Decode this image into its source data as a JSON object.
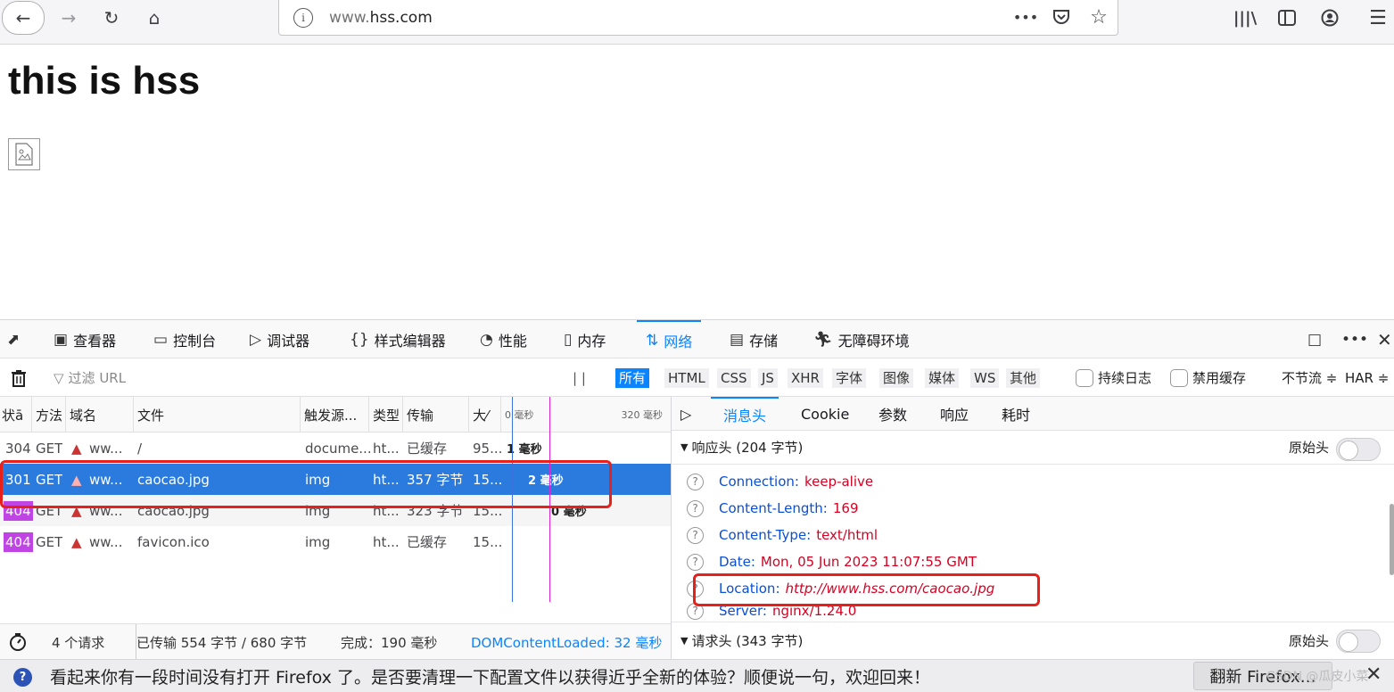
{
  "browser": {
    "url_host": "www.hss.com",
    "url_prefix": "www.",
    "url_domain": "hss.com",
    "icons": [
      "back-arrow-icon",
      "forward-arrow-icon",
      "reload-icon",
      "home-icon",
      "info-icon",
      "page-actions-icon",
      "pocket-icon",
      "bookmark-star-icon",
      "library-icon",
      "sidebar-icon",
      "account-icon",
      "menu-icon"
    ]
  },
  "page": {
    "heading": "this is hss"
  },
  "devtools": {
    "tabs": [
      {
        "label": "查看器",
        "icon": "inspector-icon"
      },
      {
        "label": "控制台",
        "icon": "console-icon"
      },
      {
        "label": "调试器",
        "icon": "debugger-icon"
      },
      {
        "label": "样式编辑器",
        "icon": "style-editor-icon"
      },
      {
        "label": "性能",
        "icon": "performance-icon"
      },
      {
        "label": "内存",
        "icon": "memory-icon"
      },
      {
        "label": "网络",
        "icon": "network-icon"
      },
      {
        "label": "存储",
        "icon": "storage-icon"
      },
      {
        "label": "无障碍环境",
        "icon": "accessibility-icon"
      }
    ],
    "selected_tab": "网络",
    "filter_placeholder": "过滤 URL",
    "pause_label": "| |",
    "type_filters": [
      "所有",
      "HTML",
      "CSS",
      "JS",
      "XHR",
      "字体",
      "图像",
      "媒体",
      "WS",
      "其他"
    ],
    "persist_logs": "持续日志",
    "disable_cache": "禁用缓存",
    "throttle": "不节流 ≑",
    "har": "HAR ≑",
    "columns": [
      "状态",
      "方法",
      "域名",
      "文件",
      "触发源...",
      "类型",
      "传输",
      "大小"
    ],
    "columns_shown": [
      "状ā",
      "方法",
      "域名",
      "文件",
      "触发源...",
      "类型",
      "传输",
      "大⁄"
    ],
    "waterfall_ticks": [
      "0 毫秒",
      "320 毫秒"
    ],
    "requests": [
      {
        "status": "304",
        "method": "GET",
        "domain": "ww...",
        "file": "/",
        "cause": "docume...",
        "type": "ht...",
        "transferred": "已缓存",
        "size": "95...",
        "timing": "1 毫秒"
      },
      {
        "status": "301",
        "method": "GET",
        "domain": "ww...",
        "file": "caocao.jpg",
        "cause": "img",
        "type": "ht...",
        "transferred": "357 字节",
        "size": "15...",
        "timing": "2 毫秒"
      },
      {
        "status": "404",
        "method": "GET",
        "domain": "ww...",
        "file": "caocao.jpg",
        "cause": "img",
        "type": "ht...",
        "transferred": "323 字节",
        "size": "15...",
        "timing": "0 毫秒"
      },
      {
        "status": "404",
        "method": "GET",
        "domain": "ww...",
        "file": "favicon.ico",
        "cause": "img",
        "type": "ht...",
        "transferred": "已缓存",
        "size": "15...",
        "timing": ""
      }
    ],
    "selected_request_index": 1,
    "summary": {
      "requests": "4 个请求",
      "transferred": "已传输 554 字节 / 680 字节",
      "finish": "完成：190 毫秒",
      "dom_loaded": "DOMContentLoaded: 32 毫秒"
    },
    "side_panel": {
      "tabs": [
        "消息头",
        "Cookie",
        "参数",
        "响应",
        "耗时"
      ],
      "selected_tab": "消息头",
      "response_headers_title": "响应头 (204 字节)",
      "raw_headers_label": "原始头",
      "response_headers": [
        {
          "name": "Connection:",
          "value": "keep-alive",
          "italic": false
        },
        {
          "name": "Content-Length:",
          "value": "169",
          "italic": false
        },
        {
          "name": "Content-Type:",
          "value": "text/html",
          "italic": false
        },
        {
          "name": "Date:",
          "value": "Mon, 05 Jun 2023 11:07:55 GMT",
          "italic": false
        },
        {
          "name": "Location:",
          "value": "http://www.hss.com/caocao.jpg",
          "italic": true
        },
        {
          "name": "Server:",
          "value": "nginx/1.24.0",
          "italic": false
        }
      ],
      "request_headers_title": "请求头 (343 字节)",
      "raw_headers_label_2": "原始头"
    }
  },
  "notification": {
    "text": "看起来你有一段时间没有打开 Firefox 了。是否要清理一下配置文件以获得近乎全新的体验？顺便说一句，欢迎回来！",
    "button": "翻新 Firefox…",
    "watermark": "CSDN @瓜皮小菜"
  },
  "colors": {
    "selected_row": "#2a7bdd",
    "accent": "#0a84ff",
    "badge_404": "#c043e3",
    "header_name": "#0a4fd7",
    "header_value": "#d70022",
    "annotation": "#e8201a"
  }
}
